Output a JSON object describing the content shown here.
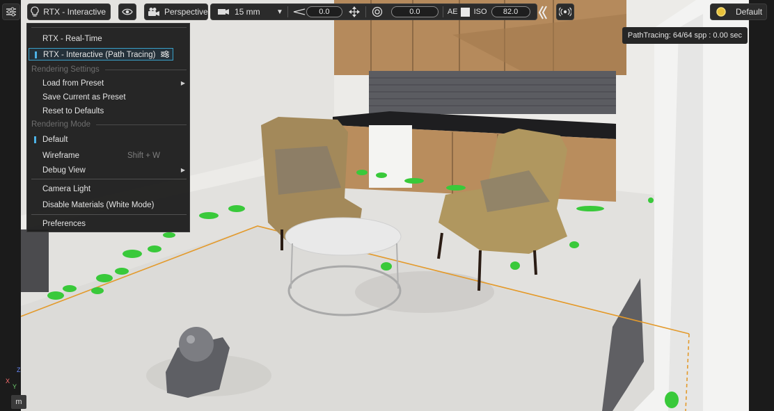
{
  "toolbar": {
    "renderer_label": "RTX - Interactive",
    "camera_label": "Perspective",
    "lens_label": "15 mm",
    "exposure_value": "0.0",
    "fstop_value": "0.0",
    "ae_label": "AE",
    "iso_label": "ISO",
    "iso_value": "82.0",
    "stage_light_label": "Default"
  },
  "status": {
    "text": "PathTracing: 64/64 spp : 0.00 sec"
  },
  "menu": {
    "realtime": "RTX - Real-Time",
    "interactive": "RTX - Interactive (Path Tracing)",
    "section_settings": "Rendering Settings",
    "load_preset": "Load from Preset",
    "save_preset": "Save Current as Preset",
    "reset_defaults": "Reset to Defaults",
    "section_mode": "Rendering Mode",
    "mode_default": "Default",
    "mode_wireframe": "Wireframe",
    "wireframe_shortcut": "Shift + W",
    "debug_view": "Debug View",
    "camera_light": "Camera Light",
    "disable_materials": "Disable Materials (White Mode)",
    "preferences": "Preferences"
  },
  "axis": {
    "z": "Z",
    "x": "X",
    "y": "Y"
  },
  "m_badge": "m",
  "icons": {
    "settings": "sliders-icon",
    "bulb": "lightbulb-icon",
    "eye": "eye-icon",
    "camera": "movie-camera-icon",
    "film": "film-icon",
    "move": "move-arrows-icon",
    "aperture": "aperture-icon",
    "exposure": "exposure-wedge-icon",
    "collapse": "double-chevron-left-icon",
    "broadcast": "broadcast-icon",
    "sun": "sun-icon"
  },
  "colors": {
    "accent": "#3aa0c8",
    "selection_bullet": "#4db2e6",
    "bounds_line": "#e39a2c",
    "sun": "#e8c13a"
  }
}
